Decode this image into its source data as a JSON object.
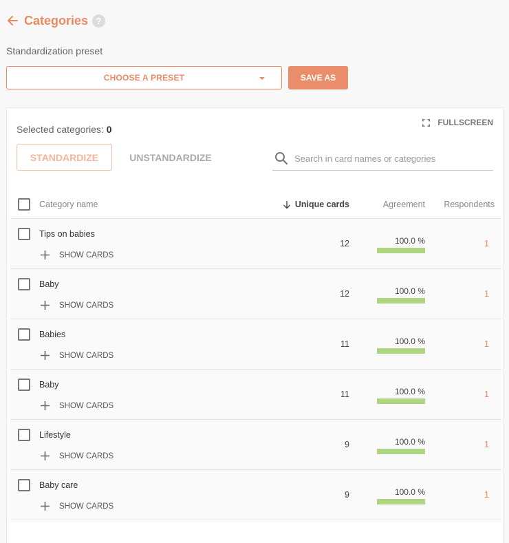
{
  "header": {
    "title": "Categories",
    "help_glyph": "?",
    "back_icon": "arrow-left-icon"
  },
  "preset": {
    "label": "Standardization preset",
    "select_value": "CHOOSE A PRESET",
    "save_as_label": "SAVE AS"
  },
  "panel": {
    "fullscreen_label": "FULLSCREEN",
    "selected_label": "Selected categories:",
    "selected_count": "0",
    "standardize_label": "STANDARDIZE",
    "unstandardize_label": "UNSTANDARDIZE",
    "search_placeholder": "Search in card names or categories",
    "search_value": ""
  },
  "table": {
    "columns": {
      "name": "Category name",
      "unique": "Unique cards",
      "agreement": "Agreement",
      "respondents": "Respondents"
    },
    "sort": {
      "column": "unique",
      "direction": "descending"
    },
    "show_cards_label": "SHOW CARDS",
    "rows": [
      {
        "name": "Tips on babies",
        "unique": "12",
        "agreement": "100.0 %",
        "agreement_value": 100,
        "respondents": "1"
      },
      {
        "name": "Baby",
        "unique": "12",
        "agreement": "100.0 %",
        "agreement_value": 100,
        "respondents": "1"
      },
      {
        "name": "Babies",
        "unique": "11",
        "agreement": "100.0 %",
        "agreement_value": 100,
        "respondents": "1"
      },
      {
        "name": "Baby",
        "unique": "11",
        "agreement": "100.0 %",
        "agreement_value": 100,
        "respondents": "1"
      },
      {
        "name": "Lifestyle",
        "unique": "9",
        "agreement": "100.0 %",
        "agreement_value": 100,
        "respondents": "1"
      },
      {
        "name": "Baby care",
        "unique": "9",
        "agreement": "100.0 %",
        "agreement_value": 100,
        "respondents": "1"
      }
    ]
  },
  "colors": {
    "accent": "#e88b64",
    "agreement_bar": "#aed581"
  }
}
